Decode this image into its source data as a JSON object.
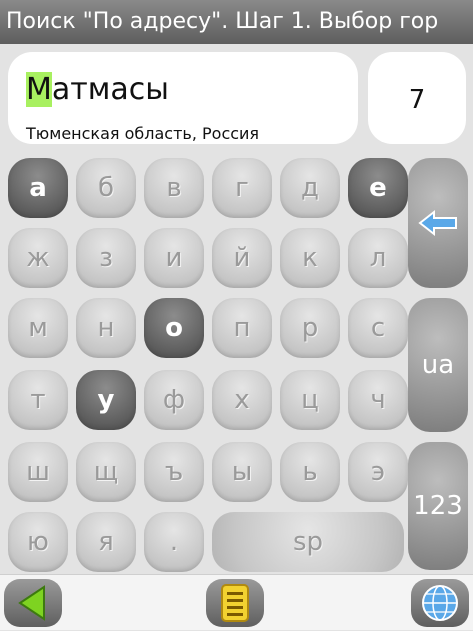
{
  "title": "Поиск \"По адресу\". Шаг 1. Выбор гор",
  "address": {
    "first_letter": "М",
    "rest": "атмасы",
    "region": "Тюменская область, Россия"
  },
  "match_count": "7",
  "keyboard": {
    "rows": [
      [
        "а",
        "б",
        "в",
        "г",
        "д",
        "е"
      ],
      [
        "ж",
        "з",
        "и",
        "й",
        "к",
        "л"
      ],
      [
        "м",
        "н",
        "о",
        "п",
        "р",
        "с"
      ],
      [
        "т",
        "у",
        "ф",
        "х",
        "ц",
        "ч"
      ],
      [
        "ш",
        "щ",
        "ъ",
        "ы",
        "ь",
        "э"
      ],
      [
        "ю",
        "я",
        "."
      ]
    ],
    "active": [
      "а",
      "е",
      "о",
      "у"
    ],
    "space_label": "sp",
    "lang_label": "ua",
    "num_label": "123"
  },
  "icons": {
    "backspace": "arrow-left-icon",
    "back": "triangle-left-icon",
    "menu": "list-icon",
    "globe": "globe-icon"
  },
  "colors": {
    "highlight": "#a8f060",
    "active_key": "#6a6a6a",
    "accent_blue": "#5aa8e8",
    "back_green": "#7ed321",
    "menu_yellow": "#f2d230"
  }
}
